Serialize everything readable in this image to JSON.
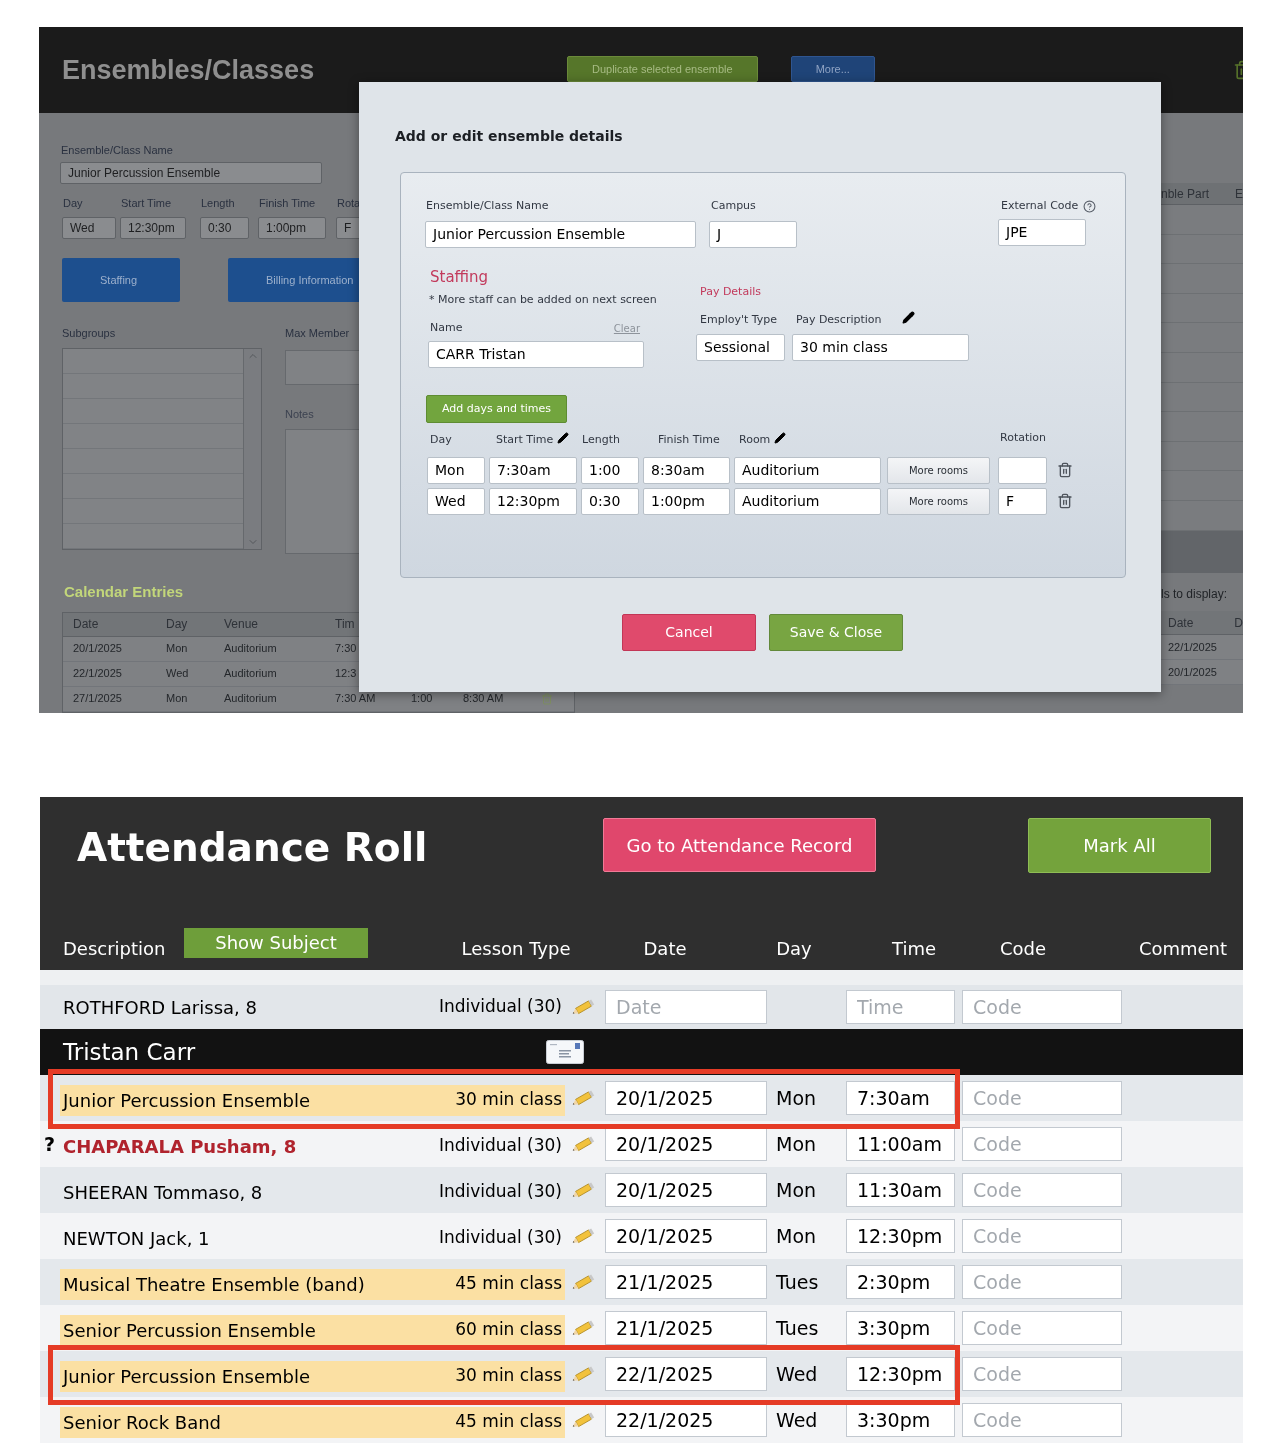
{
  "ensembles_screen": {
    "title": "Ensembles/Classes",
    "header_buttons": [
      {
        "label": "Duplicate selected ensemble",
        "kind": "green"
      },
      {
        "label": "More...",
        "kind": "blue"
      }
    ],
    "form": {
      "name_label": "Ensemble/Class Name",
      "name_value": "Junior Percussion Ensemble",
      "fields": [
        {
          "label": "Day",
          "value": "Wed"
        },
        {
          "label": "Start Time",
          "value": "12:30pm"
        },
        {
          "label": "Length",
          "value": "0:30"
        },
        {
          "label": "Finish Time",
          "value": "1:00pm"
        },
        {
          "label": "Rota",
          "value": "F"
        }
      ],
      "buttons": [
        "Staffing",
        "Billing Information"
      ],
      "subgroups_label": "Subgroups",
      "max_members_label": "Max Member",
      "notes_label": "Notes"
    },
    "calendar": {
      "title": "Calendar Entries",
      "columns": [
        "Date",
        "Day",
        "Venue",
        "Tim"
      ],
      "rows": [
        [
          "20/1/2025",
          "Mon",
          "Auditorium",
          "7:30"
        ],
        [
          "22/1/2025",
          "Wed",
          "Auditorium",
          "12:3"
        ],
        [
          "27/1/2025",
          "Mon",
          "Auditorium",
          "7:30 AM",
          "1:00",
          "8:30 AM"
        ]
      ]
    },
    "right_panel": {
      "columns": [
        "nble Part",
        "E"
      ],
      "display_label": "ls to display:",
      "table_columns": [
        "Date",
        "D"
      ],
      "rows": [
        "22/1/2025",
        "20/1/2025"
      ]
    }
  },
  "modal": {
    "title": "Add or edit ensemble details",
    "name_label": "Ensemble/Class Name",
    "name_value": "Junior Percussion Ensemble",
    "campus_label": "Campus",
    "campus_value": "J",
    "external_code_label": "External Code",
    "external_code_value": "JPE",
    "staffing_title": "Staffing",
    "staffing_note": "* More staff can be added on next screen",
    "pay_details_title": "Pay Details",
    "staff_name_label": "Name",
    "clear_link": "Clear",
    "staff_name_value": "CARR Tristan",
    "employ_type_label": "Employ't Type",
    "employ_type_value": "Sessional",
    "pay_description_label": "Pay Description",
    "pay_description_value": "30 min class",
    "add_button": "Add days and times",
    "schedule_columns": [
      "Day",
      "Start Time",
      "Length",
      "Finish Time",
      "Room",
      "Rotation"
    ],
    "schedule_rows": [
      {
        "day": "Mon",
        "start": "7:30am",
        "length": "1:00",
        "finish": "8:30am",
        "room": "Auditorium",
        "rooms_button": "More rooms"
      },
      {
        "day": "Wed",
        "start": "12:30pm",
        "length": "0:30",
        "finish": "1:00pm",
        "room": "Auditorium",
        "rooms_button": "More rooms",
        "rotation": "F"
      }
    ],
    "buttons": [
      {
        "label": "Cancel",
        "kind": "cancel"
      },
      {
        "label": "Save & Close",
        "kind": "save"
      }
    ]
  },
  "attendance": {
    "title": "Attendance Roll",
    "buttons": [
      {
        "label": "Go to Attendance Record",
        "kind": "pink"
      },
      {
        "label": "Mark All",
        "kind": "green"
      }
    ],
    "description_header": "Description",
    "show_subject_button": "Show Subject",
    "columns": [
      "Lesson Type",
      "Date",
      "Day",
      "Time",
      "Code",
      "Comment"
    ],
    "top_row": {
      "name": "ROTHFORD Larissa, 8",
      "lesson_type": "Individual (30)",
      "date_placeholder": "Date",
      "time_placeholder": "Time",
      "code_placeholder": "Code"
    },
    "group": "Tristan Carr",
    "rows": [
      {
        "kind": "ensemble",
        "name": "Junior Percussion Ensemble",
        "lesson_type": "30 min class",
        "date": "20/1/2025",
        "day": "Mon",
        "time": "7:30am",
        "code_placeholder": "Code",
        "highlighted": true,
        "flagged": false
      },
      {
        "kind": "student",
        "marker": "?",
        "name": "CHAPARALA Pusham, 8",
        "lesson_type": "Individual (30)",
        "date": "20/1/2025",
        "day": "Mon",
        "time": "11:00am",
        "code_placeholder": "Code",
        "highlighted": false,
        "flagged": true
      },
      {
        "kind": "student",
        "name": "SHEERAN Tommaso, 8",
        "lesson_type": "Individual (30)",
        "date": "20/1/2025",
        "day": "Mon",
        "time": "11:30am",
        "code_placeholder": "Code",
        "highlighted": false,
        "flagged": false
      },
      {
        "kind": "student",
        "name": "NEWTON Jack, 1",
        "lesson_type": "Individual (30)",
        "date": "20/1/2025",
        "day": "Mon",
        "time": "12:30pm",
        "code_placeholder": "Code",
        "highlighted": false,
        "flagged": false
      },
      {
        "kind": "ensemble",
        "name": "Musical Theatre Ensemble (band)",
        "lesson_type": "45 min class",
        "date": "21/1/2025",
        "day": "Tues",
        "time": "2:30pm",
        "code_placeholder": "Code",
        "highlighted": false,
        "flagged": false
      },
      {
        "kind": "ensemble",
        "name": "Senior Percussion Ensemble",
        "lesson_type": "60 min class",
        "date": "21/1/2025",
        "day": "Tues",
        "time": "3:30pm",
        "code_placeholder": "Code",
        "highlighted": false,
        "flagged": false
      },
      {
        "kind": "ensemble",
        "name": "Junior Percussion Ensemble",
        "lesson_type": "30 min class",
        "date": "22/1/2025",
        "day": "Wed",
        "time": "12:30pm",
        "code_placeholder": "Code",
        "highlighted": true,
        "flagged": false
      },
      {
        "kind": "ensemble",
        "name": "Senior Rock Band",
        "lesson_type": "45 min class",
        "date": "22/1/2025",
        "day": "Wed",
        "time": "3:30pm",
        "code_placeholder": "Code",
        "highlighted": false,
        "flagged": false
      }
    ]
  }
}
